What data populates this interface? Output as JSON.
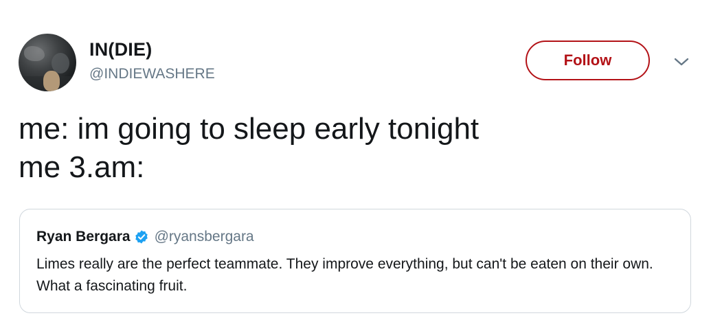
{
  "author": {
    "display_name": "IN(DIE)",
    "handle": "@INDIEWASHERE"
  },
  "follow_button": {
    "label": "Follow",
    "color": "#b31217"
  },
  "more_menu": {
    "icon": "chevron-down-icon"
  },
  "tweet": {
    "lines": [
      "me: im going to sleep early tonight",
      "me 3.am:"
    ]
  },
  "quoted_tweet": {
    "display_name": "Ryan Bergara",
    "verified_icon": "verified-badge-icon",
    "verified_color": "#1da1f2",
    "handle": "@ryansbergara",
    "text": "Limes really are the perfect teammate. They improve everything, but can't be eaten on their own. What a fascinating fruit."
  }
}
